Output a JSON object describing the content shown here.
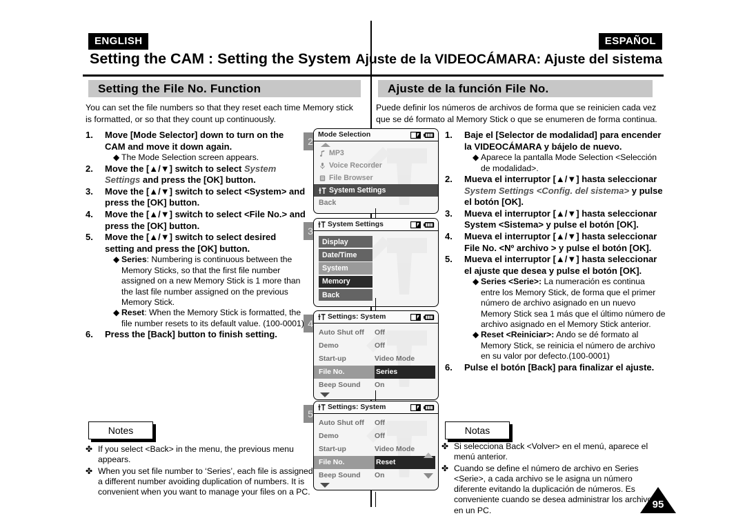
{
  "header": {
    "lang_en": "ENGLISH",
    "lang_es": "ESPAÑOL",
    "chapter_en": "Setting the CAM : Setting the System",
    "chapter_es": "Ajuste de la VIDEOCÁMARA: Ajuste del sistema",
    "section_en": "Setting the File No. Function",
    "section_es": "Ajuste de la función File No."
  },
  "intro": {
    "en": "You can set the file numbers so that they reset each time Memory stick is formatted, or so that they count up continuously.",
    "es": "Puede definir los números de archivos de forma que se reinicien cada vez que se dé formato al Memory Stick o que se enumeren de forma continua."
  },
  "steps_en": [
    {
      "num": "1.",
      "text": "Move [Mode Selector] down to turn on the CAM and move it down again.",
      "bullets": [
        {
          "mark": "◆",
          "text": "The Mode Selection screen appears."
        }
      ]
    },
    {
      "num": "2.",
      "text_pre": "Move the [▲/▼] switch to select ",
      "text_italic": "System Settings",
      "text_post": " and press the [OK] button.",
      "bullets": []
    },
    {
      "num": "3.",
      "text": "Move the [▲/▼] switch to select <System> and press the [OK] button.",
      "bullets": []
    },
    {
      "num": "4.",
      "text": "Move the [▲/▼] switch to select <File No.> and press the [OK] button.",
      "bullets": []
    },
    {
      "num": "5.",
      "text": "Move the [▲/▼] switch to select desired setting and press the [OK] button.",
      "bullets": [
        {
          "mark": "◆",
          "label": "Series",
          "body": ": Numbering is continuous between the Memory Sticks, so that the first file number assigned on a new Memory Stick is 1 more than the last file number assigned on the previous Memory Stick."
        },
        {
          "mark": "◆",
          "label": "Reset",
          "body": ": When the Memory Stick is formatted, the file number resets to its default value. (100-0001)"
        }
      ]
    },
    {
      "num": "6.",
      "text": "Press the [Back] button to finish setting.",
      "bullets": []
    }
  ],
  "steps_es": [
    {
      "num": "1.",
      "text": "Baje el [Selector de modalidad] para encender la VIDEOCÁMARA y bájelo de nuevo.",
      "bullets": [
        {
          "mark": "◆",
          "text": "Aparece la pantalla Mode Selection <Selección de modalidad>."
        }
      ]
    },
    {
      "num": "2.",
      "text_pre": "Mueva el interruptor [▲/▼] hasta seleccionar ",
      "text_italic": "System Settings <Config. del sistema>",
      "text_post": " y pulse el botón [OK].",
      "bullets": []
    },
    {
      "num": "3.",
      "text": "Mueva el interruptor [▲/▼] hasta seleccionar System <Sistema> y pulse el botón [OK].",
      "bullets": []
    },
    {
      "num": "4.",
      "text": "Mueva el interruptor [▲/▼] hasta seleccionar File No. <Nº archivo > y pulse el botón [OK].",
      "bullets": []
    },
    {
      "num": "5.",
      "text": "Mueva el interruptor [▲/▼] hasta seleccionar el ajuste que desea y pulse el botón [OK].",
      "bullets": [
        {
          "mark": "◆",
          "label": "Series <Serie>:",
          "body": " La numeración es continua entre los Memory Stick, de forma que el primer número de archivo asignado en un nuevo Memory Stick sea 1 más que el último número de archivo asignado en el Memory Stick anterior."
        },
        {
          "mark": "◆",
          "label": "Reset <Reiniciar>:",
          "body": " Ando se dé formato al Memory Stick, se reinicia el número de archivo en su valor por defecto.(100-0001)"
        }
      ]
    },
    {
      "num": "6.",
      "text": "Pulse el botón [Back] para finalizar el ajuste.",
      "bullets": []
    }
  ],
  "notes": {
    "title_en": "Notes",
    "title_es": "Notas",
    "mark": "✤",
    "items_en": [
      "If you select <Back> in the menu, the previous menu appears.",
      "When you set file number to ‘Series’, each file is assigned a different number avoiding duplication of numbers. It is convenient when you want to manage your files on a PC."
    ],
    "items_es": [
      "Si selecciona Back <Volver> en el menú, aparece el menú anterior.",
      "Cuando se define el número de archivo en Series <Serie>, a cada archivo se le asigna un número diferente evitando la duplicación de números.  Es conveniente cuando se desea administrar los archivos en un PC."
    ]
  },
  "page_number": "95",
  "screens": [
    {
      "badge": "2",
      "title": "Mode Selection",
      "title_icon": "",
      "type": "mode-list",
      "top_arrow": true,
      "rows": [
        {
          "icon": "music-note-icon",
          "label": "MP3",
          "state": "normal"
        },
        {
          "icon": "microphone-icon",
          "label": "Voice Recorder",
          "state": "normal"
        },
        {
          "icon": "document-icon",
          "label": "File Browser",
          "state": "normal"
        },
        {
          "icon": "settings-sliders-icon",
          "label": "System Settings",
          "state": "selected"
        },
        {
          "icon": "",
          "label": "Back",
          "state": "plain"
        }
      ]
    },
    {
      "badge": "3",
      "title": "System Settings",
      "title_icon": "settings-sliders-icon",
      "type": "button-list",
      "rows": [
        {
          "label": "Display",
          "shade": "g1"
        },
        {
          "label": "Date/Time",
          "shade": "g1"
        },
        {
          "label": "System",
          "shade": "g2"
        },
        {
          "label": "Memory",
          "shade": "g3"
        },
        {
          "label": "Back",
          "shade": "g1"
        }
      ]
    },
    {
      "badge": "4",
      "title": "Settings: System",
      "title_icon": "settings-sliders-icon",
      "type": "kv-list",
      "scroll_down": true,
      "side_arrows": false,
      "rows": [
        {
          "key": "Auto Shut off",
          "value": "Off",
          "selected": false
        },
        {
          "key": "Demo",
          "value": "Off",
          "selected": false
        },
        {
          "key": "Start-up",
          "value": "Video Mode",
          "selected": false
        },
        {
          "key": "File No.",
          "value": "Series",
          "selected": true
        },
        {
          "key": "Beep Sound",
          "value": "On",
          "selected": false
        }
      ]
    },
    {
      "badge": "5",
      "title": "Settings: System",
      "title_icon": "settings-sliders-icon",
      "type": "kv-list",
      "scroll_down": true,
      "side_arrows": true,
      "rows": [
        {
          "key": "Auto Shut off",
          "value": "Off",
          "selected": false
        },
        {
          "key": "Demo",
          "value": "Off",
          "selected": false
        },
        {
          "key": "Start-up",
          "value": "Video Mode",
          "selected": false
        },
        {
          "key": "File No.",
          "value": "Reset",
          "selected": true
        },
        {
          "key": "Beep Sound",
          "value": "On",
          "selected": false
        }
      ]
    }
  ],
  "status_icons": {
    "card": "memory-card-icon",
    "battery": "battery-icon"
  }
}
